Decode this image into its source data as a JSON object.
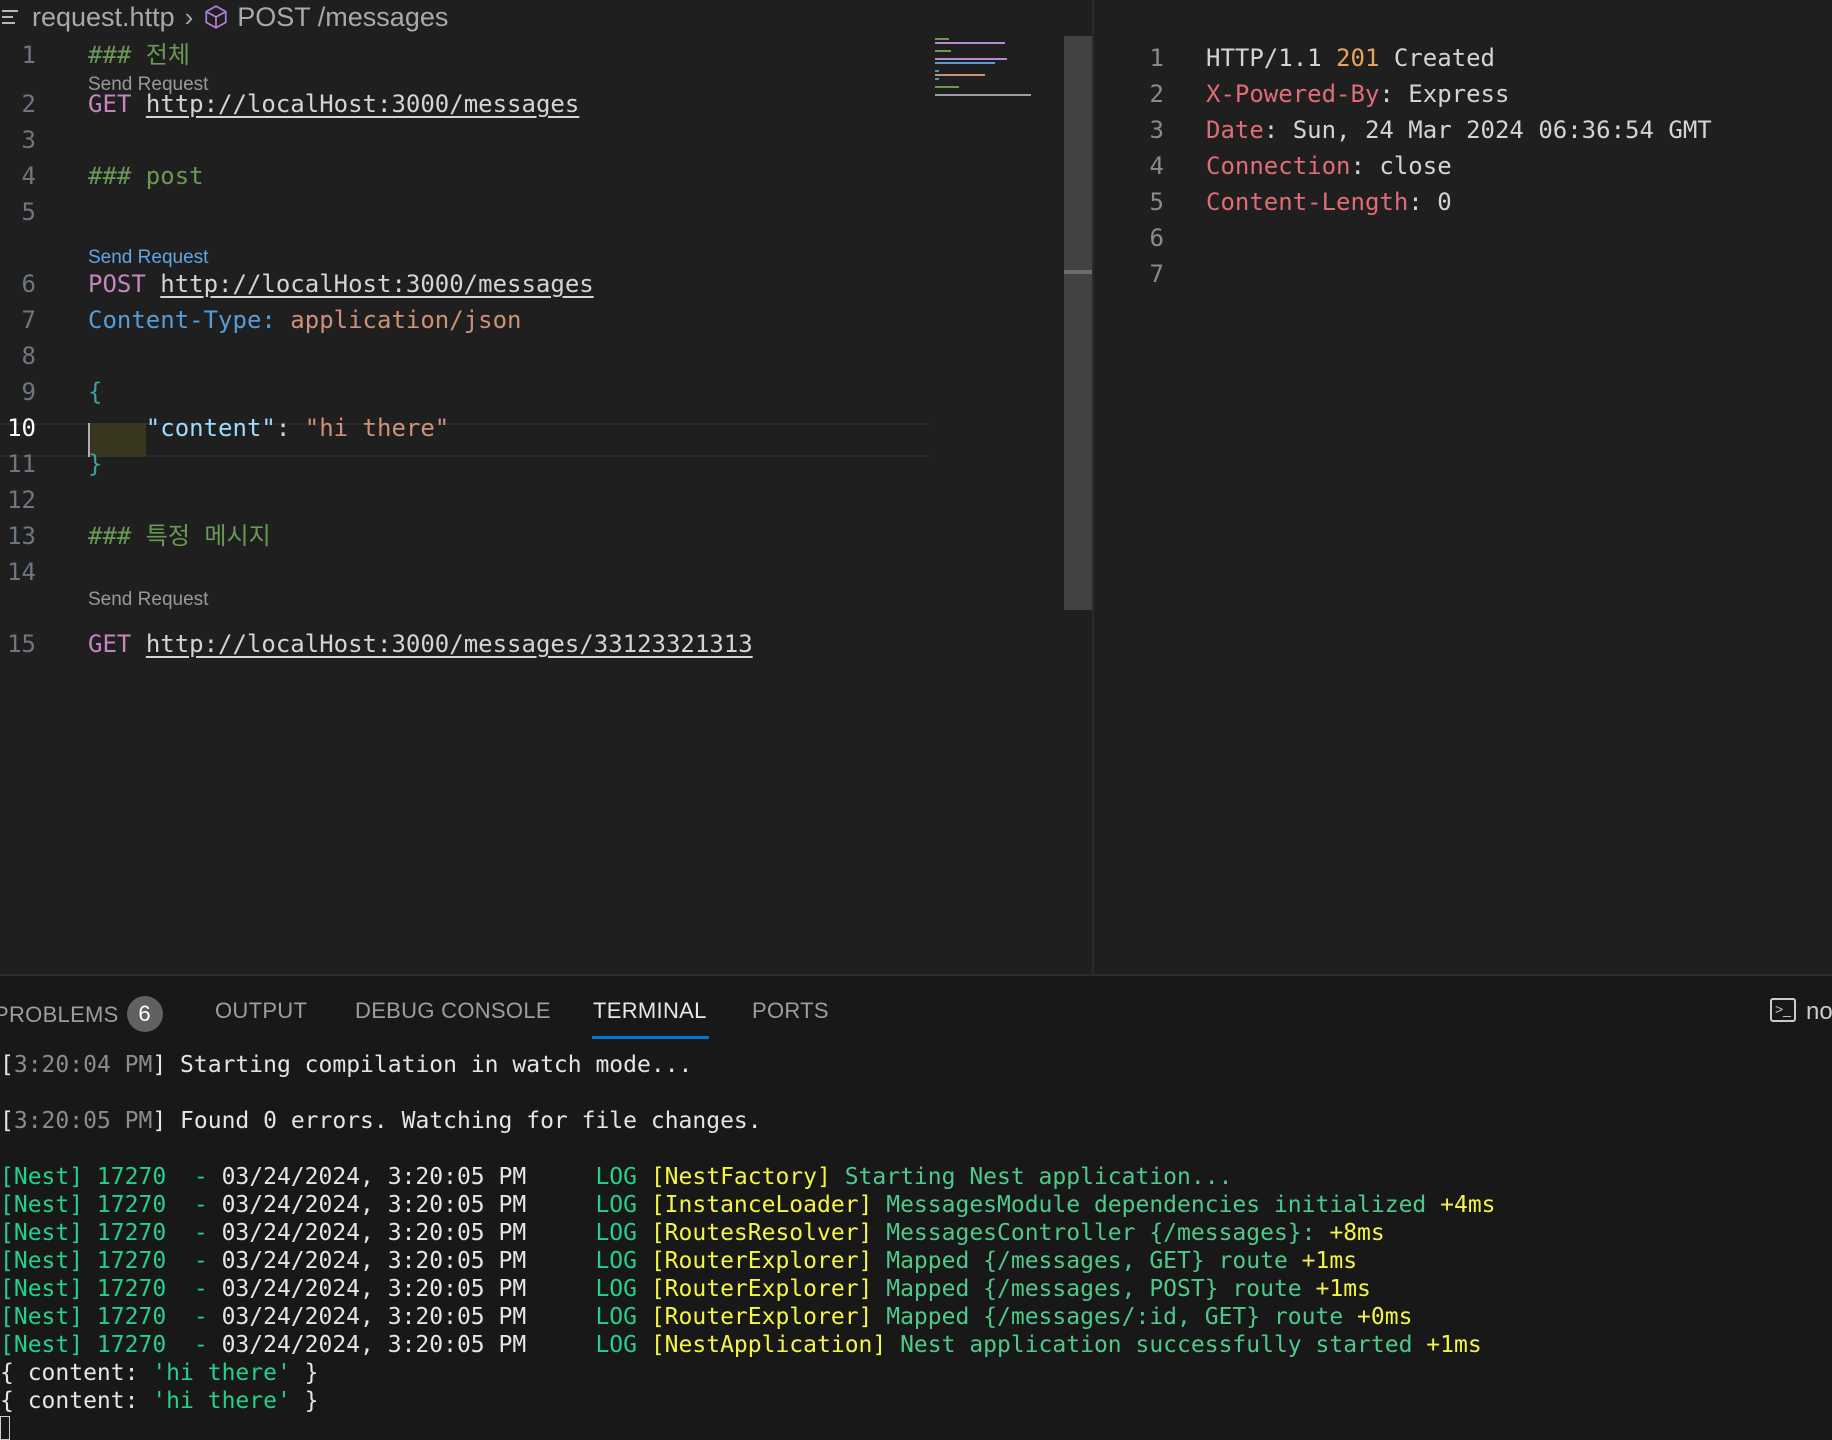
{
  "breadcrumb": {
    "file": "request.http",
    "symbol": "POST /messages"
  },
  "editor": {
    "codelens": "Send Request",
    "lines": [
      {
        "n": "1",
        "comment": "### 전체"
      },
      {
        "n": "2",
        "method": "GET",
        "url": "http://localHost:3000/messages"
      },
      {
        "n": "3"
      },
      {
        "n": "4",
        "comment": "### post"
      },
      {
        "n": "5"
      },
      {
        "n": "6",
        "method": "POST",
        "url": "http://localHost:3000/messages"
      },
      {
        "n": "7",
        "header_key": "Content-Type:",
        "header_value": "application/json"
      },
      {
        "n": "8"
      },
      {
        "n": "9",
        "text": "{"
      },
      {
        "n": "10",
        "json_key": "\"content\"",
        "colon": ": ",
        "json_value": "\"hi there\""
      },
      {
        "n": "11",
        "text": "}"
      },
      {
        "n": "12"
      },
      {
        "n": "13",
        "comment": "### 특정 메시지"
      },
      {
        "n": "14"
      },
      {
        "n": "15",
        "method": "GET",
        "url": "http://localHost:3000/messages/33123321313"
      }
    ]
  },
  "response": {
    "lines": [
      {
        "n": "1",
        "protocol": "HTTP/1.1",
        "status_code": "201",
        "status_text": "Created"
      },
      {
        "n": "2",
        "key": "X-Powered-By",
        "value": ": Express"
      },
      {
        "n": "3",
        "key": "Date",
        "value": ": Sun, 24 Mar 2024 06:36:54 GMT"
      },
      {
        "n": "4",
        "key": "Connection",
        "value": ": close"
      },
      {
        "n": "5",
        "key": "Content-Length",
        "value": ": 0"
      },
      {
        "n": "6"
      },
      {
        "n": "7"
      }
    ]
  },
  "panel": {
    "tabs": [
      "PROBLEMS",
      "OUTPUT",
      "DEBUG CONSOLE",
      "TERMINAL",
      "PORTS"
    ],
    "problems_count": "6",
    "active_tab": "TERMINAL",
    "terminal_name": "no"
  },
  "terminal": {
    "compile_lines": [
      {
        "time": "3:20:04 PM",
        "msg": "Starting compilation in watch mode..."
      },
      {
        "time": "3:20:05 PM",
        "msg": "Found 0 errors. Watching for file changes."
      }
    ],
    "nest_prefix": "[Nest] 17270  - ",
    "nest_time": "03/24/2024, 3:20:05 PM",
    "log_level": "LOG",
    "logs": [
      {
        "ctx": "[NestFactory]",
        "msg": "Starting Nest application...",
        "delta": ""
      },
      {
        "ctx": "[InstanceLoader]",
        "msg": "MessagesModule dependencies initialized",
        "delta": "+4ms"
      },
      {
        "ctx": "[RoutesResolver]",
        "msg": "MessagesController {/messages}:",
        "delta": "+8ms"
      },
      {
        "ctx": "[RouterExplorer]",
        "msg": "Mapped {/messages, GET} route",
        "delta": "+1ms"
      },
      {
        "ctx": "[RouterExplorer]",
        "msg": "Mapped {/messages, POST} route",
        "delta": "+1ms"
      },
      {
        "ctx": "[RouterExplorer]",
        "msg": "Mapped {/messages/:id, GET} route",
        "delta": "+0ms"
      },
      {
        "ctx": "[NestApplication]",
        "msg": "Nest application successfully started",
        "delta": "+1ms"
      }
    ],
    "output_lines": [
      {
        "pre": "{ content: ",
        "str": "'hi there'",
        "post": " }"
      },
      {
        "pre": "{ content: ",
        "str": "'hi there'",
        "post": " }"
      }
    ]
  },
  "colors": {
    "background": "#1e1e1e",
    "accent": "#0078d4",
    "comment": "#6a9955",
    "method": "#c586c0",
    "status_code": "#e9a35b",
    "header_key": "#e06c75",
    "terminal_green": "#23d18b",
    "terminal_yellow": "#f5f543"
  }
}
